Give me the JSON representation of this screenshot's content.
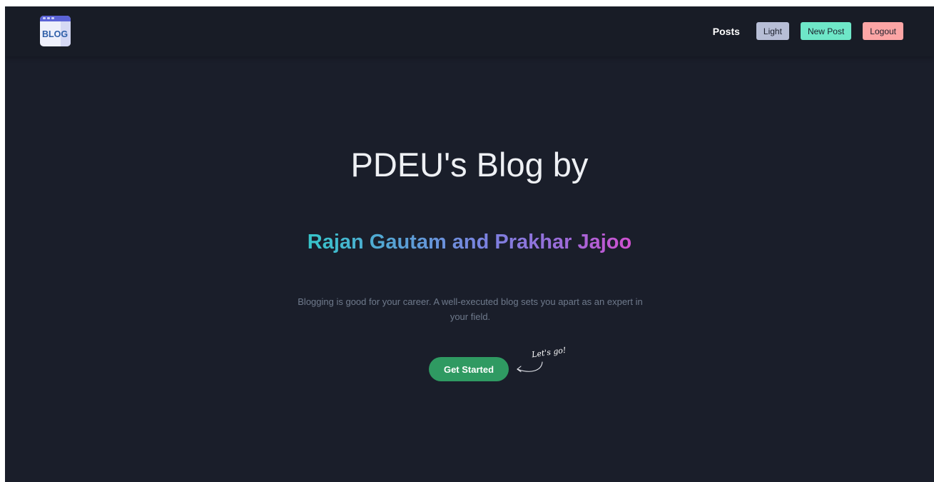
{
  "header": {
    "logo_text": "BLOG",
    "nav": {
      "posts_label": "Posts",
      "light_label": "Light",
      "new_post_label": "New Post",
      "logout_label": "Logout"
    }
  },
  "hero": {
    "title": "PDEU's Blog by",
    "subtitle": "Rajan Gautam and Prakhar Jajoo",
    "description": "Blogging is good for your career. A well-executed blog sets you apart as an expert in your field.",
    "cta_label": "Get Started",
    "annotation": "Let's go!"
  },
  "colors": {
    "background": "#1a1e2a",
    "header": "#181c26",
    "light_button": "#b7bed6",
    "new_post_button": "#6ee7c8",
    "logout_button": "#fca5a5",
    "cta_button": "#2f9a62",
    "gradient": [
      "#36c5c9",
      "#7b82e0",
      "#d050d0"
    ]
  },
  "icons": [
    "blog-logo-icon",
    "curved-arrow-icon"
  ]
}
